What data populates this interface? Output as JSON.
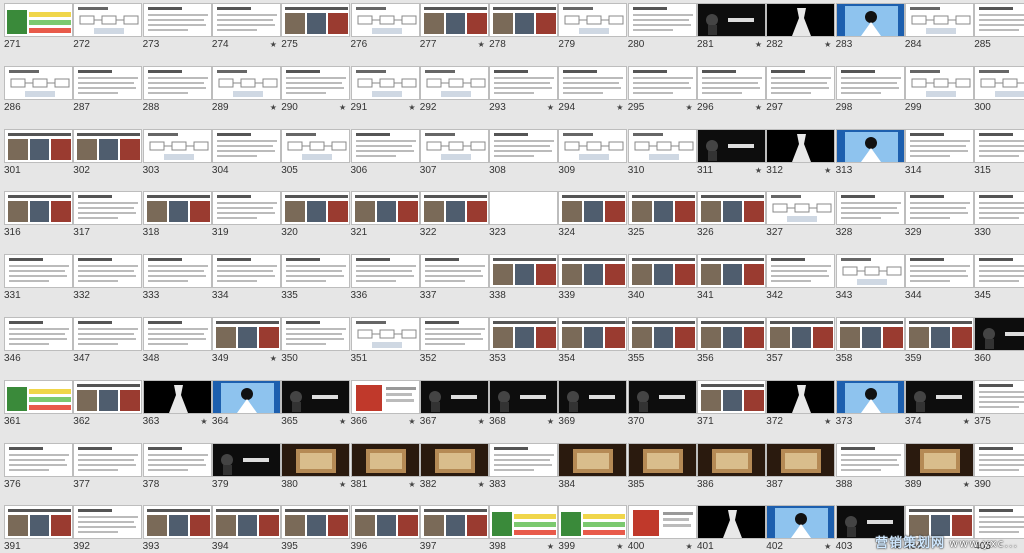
{
  "view": "slide-sorter",
  "watermark": {
    "text": "营销策划网",
    "url": "www.yxc..."
  },
  "slides": [
    {
      "n": "271",
      "s": "",
      "k": "green"
    },
    {
      "n": "272",
      "s": "",
      "k": "diagram"
    },
    {
      "n": "273",
      "s": "",
      "k": "doc"
    },
    {
      "n": "274",
      "s": "★",
      "k": "doc"
    },
    {
      "n": "275",
      "s": "",
      "k": "photo"
    },
    {
      "n": "276",
      "s": "",
      "k": "diagram"
    },
    {
      "n": "277",
      "s": "★",
      "k": "photo"
    },
    {
      "n": "278",
      "s": "",
      "k": "photo"
    },
    {
      "n": "279",
      "s": "",
      "k": "diagram"
    },
    {
      "n": "280",
      "s": "",
      "k": "doc"
    },
    {
      "n": "281",
      "s": "★",
      "k": "dark"
    },
    {
      "n": "282",
      "s": "★",
      "k": "dress"
    },
    {
      "n": "283",
      "s": "",
      "k": "blue"
    },
    {
      "n": "284",
      "s": "",
      "k": "diagram"
    },
    {
      "n": "285",
      "s": "",
      "k": "doc"
    },
    {
      "n": "286",
      "s": "",
      "k": "diagram"
    },
    {
      "n": "287",
      "s": "",
      "k": "doc"
    },
    {
      "n": "288",
      "s": "",
      "k": "doc"
    },
    {
      "n": "289",
      "s": "★",
      "k": "diagram"
    },
    {
      "n": "290",
      "s": "★",
      "k": "doc"
    },
    {
      "n": "291",
      "s": "★",
      "k": "diagram"
    },
    {
      "n": "292",
      "s": "",
      "k": "diagram"
    },
    {
      "n": "293",
      "s": "★",
      "k": "doc"
    },
    {
      "n": "294",
      "s": "★",
      "k": "doc"
    },
    {
      "n": "295",
      "s": "★",
      "k": "doc"
    },
    {
      "n": "296",
      "s": "★",
      "k": "doc"
    },
    {
      "n": "297",
      "s": "",
      "k": "doc"
    },
    {
      "n": "298",
      "s": "",
      "k": "doc"
    },
    {
      "n": "299",
      "s": "",
      "k": "diagram"
    },
    {
      "n": "300",
      "s": "★",
      "k": "diagram"
    },
    {
      "n": "301",
      "s": "",
      "k": "photo"
    },
    {
      "n": "302",
      "s": "",
      "k": "photo"
    },
    {
      "n": "303",
      "s": "",
      "k": "diagram"
    },
    {
      "n": "304",
      "s": "",
      "k": "doc"
    },
    {
      "n": "305",
      "s": "",
      "k": "diagram"
    },
    {
      "n": "306",
      "s": "",
      "k": "doc"
    },
    {
      "n": "307",
      "s": "",
      "k": "diagram"
    },
    {
      "n": "308",
      "s": "",
      "k": "doc"
    },
    {
      "n": "309",
      "s": "",
      "k": "diagram"
    },
    {
      "n": "310",
      "s": "",
      "k": "diagram"
    },
    {
      "n": "311",
      "s": "★",
      "k": "dark"
    },
    {
      "n": "312",
      "s": "★",
      "k": "dress"
    },
    {
      "n": "313",
      "s": "",
      "k": "blue"
    },
    {
      "n": "314",
      "s": "",
      "k": "doc"
    },
    {
      "n": "315",
      "s": "",
      "k": "doc"
    },
    {
      "n": "316",
      "s": "",
      "k": "photo"
    },
    {
      "n": "317",
      "s": "",
      "k": "doc"
    },
    {
      "n": "318",
      "s": "",
      "k": "photo"
    },
    {
      "n": "319",
      "s": "",
      "k": "doc"
    },
    {
      "n": "320",
      "s": "",
      "k": "photo"
    },
    {
      "n": "321",
      "s": "",
      "k": "photo"
    },
    {
      "n": "322",
      "s": "",
      "k": "photo"
    },
    {
      "n": "323",
      "s": "",
      "k": "blank"
    },
    {
      "n": "324",
      "s": "",
      "k": "photo"
    },
    {
      "n": "325",
      "s": "",
      "k": "photo"
    },
    {
      "n": "326",
      "s": "",
      "k": "photo"
    },
    {
      "n": "327",
      "s": "",
      "k": "diagram"
    },
    {
      "n": "328",
      "s": "",
      "k": "doc"
    },
    {
      "n": "329",
      "s": "",
      "k": "doc"
    },
    {
      "n": "330",
      "s": "",
      "k": "doc"
    },
    {
      "n": "331",
      "s": "",
      "k": "doc"
    },
    {
      "n": "332",
      "s": "",
      "k": "doc"
    },
    {
      "n": "333",
      "s": "",
      "k": "doc"
    },
    {
      "n": "334",
      "s": "",
      "k": "doc"
    },
    {
      "n": "335",
      "s": "",
      "k": "doc"
    },
    {
      "n": "336",
      "s": "",
      "k": "doc"
    },
    {
      "n": "337",
      "s": "",
      "k": "doc"
    },
    {
      "n": "338",
      "s": "",
      "k": "photo"
    },
    {
      "n": "339",
      "s": "",
      "k": "photo"
    },
    {
      "n": "340",
      "s": "",
      "k": "photo"
    },
    {
      "n": "341",
      "s": "",
      "k": "photo"
    },
    {
      "n": "342",
      "s": "",
      "k": "doc"
    },
    {
      "n": "343",
      "s": "",
      "k": "diagram"
    },
    {
      "n": "344",
      "s": "",
      "k": "doc"
    },
    {
      "n": "345",
      "s": "",
      "k": "doc"
    },
    {
      "n": "346",
      "s": "",
      "k": "doc"
    },
    {
      "n": "347",
      "s": "",
      "k": "doc"
    },
    {
      "n": "348",
      "s": "",
      "k": "doc"
    },
    {
      "n": "349",
      "s": "★",
      "k": "photo"
    },
    {
      "n": "350",
      "s": "",
      "k": "doc"
    },
    {
      "n": "351",
      "s": "",
      "k": "diagram"
    },
    {
      "n": "352",
      "s": "",
      "k": "doc"
    },
    {
      "n": "353",
      "s": "",
      "k": "photo"
    },
    {
      "n": "354",
      "s": "",
      "k": "photo"
    },
    {
      "n": "355",
      "s": "",
      "k": "photo"
    },
    {
      "n": "356",
      "s": "",
      "k": "photo"
    },
    {
      "n": "357",
      "s": "",
      "k": "photo"
    },
    {
      "n": "358",
      "s": "",
      "k": "photo"
    },
    {
      "n": "359",
      "s": "",
      "k": "photo"
    },
    {
      "n": "360",
      "s": "",
      "k": "dark"
    },
    {
      "n": "361",
      "s": "",
      "k": "green"
    },
    {
      "n": "362",
      "s": "",
      "k": "photo"
    },
    {
      "n": "363",
      "s": "★",
      "k": "dress"
    },
    {
      "n": "364",
      "s": "",
      "k": "blue"
    },
    {
      "n": "365",
      "s": "★",
      "k": "dark"
    },
    {
      "n": "366",
      "s": "★",
      "k": "red"
    },
    {
      "n": "367",
      "s": "★",
      "k": "dark"
    },
    {
      "n": "368",
      "s": "★",
      "k": "dark"
    },
    {
      "n": "369",
      "s": "",
      "k": "dark"
    },
    {
      "n": "370",
      "s": "",
      "k": "dark"
    },
    {
      "n": "371",
      "s": "",
      "k": "photo"
    },
    {
      "n": "372",
      "s": "★",
      "k": "dress"
    },
    {
      "n": "373",
      "s": "",
      "k": "blue"
    },
    {
      "n": "374",
      "s": "★",
      "k": "dark"
    },
    {
      "n": "375",
      "s": "",
      "k": "doc"
    },
    {
      "n": "376",
      "s": "",
      "k": "doc"
    },
    {
      "n": "377",
      "s": "",
      "k": "doc"
    },
    {
      "n": "378",
      "s": "",
      "k": "doc"
    },
    {
      "n": "379",
      "s": "",
      "k": "dark"
    },
    {
      "n": "380",
      "s": "★",
      "k": "brown"
    },
    {
      "n": "381",
      "s": "★",
      "k": "brown"
    },
    {
      "n": "382",
      "s": "★",
      "k": "brown"
    },
    {
      "n": "383",
      "s": "",
      "k": "doc"
    },
    {
      "n": "384",
      "s": "",
      "k": "brown"
    },
    {
      "n": "385",
      "s": "",
      "k": "brown"
    },
    {
      "n": "386",
      "s": "",
      "k": "brown"
    },
    {
      "n": "387",
      "s": "",
      "k": "brown"
    },
    {
      "n": "388",
      "s": "",
      "k": "doc"
    },
    {
      "n": "389",
      "s": "★",
      "k": "brown"
    },
    {
      "n": "390",
      "s": "",
      "k": "doc"
    },
    {
      "n": "391",
      "s": "",
      "k": "photo"
    },
    {
      "n": "392",
      "s": "",
      "k": "doc"
    },
    {
      "n": "393",
      "s": "",
      "k": "photo"
    },
    {
      "n": "394",
      "s": "",
      "k": "photo"
    },
    {
      "n": "395",
      "s": "",
      "k": "photo"
    },
    {
      "n": "396",
      "s": "",
      "k": "photo"
    },
    {
      "n": "397",
      "s": "",
      "k": "photo"
    },
    {
      "n": "398",
      "s": "★",
      "k": "green"
    },
    {
      "n": "399",
      "s": "★",
      "k": "green"
    },
    {
      "n": "400",
      "s": "★",
      "k": "red"
    },
    {
      "n": "401",
      "s": "",
      "k": "dress"
    },
    {
      "n": "402",
      "s": "★",
      "k": "blue"
    },
    {
      "n": "403",
      "s": "★",
      "k": "dark"
    },
    {
      "n": "404",
      "s": "",
      "k": "photo"
    },
    {
      "n": "405",
      "s": "",
      "k": "doc"
    }
  ]
}
